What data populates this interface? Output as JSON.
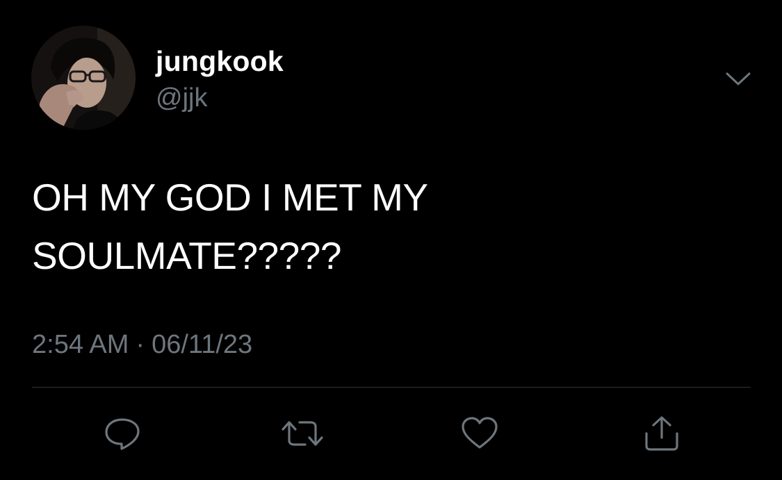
{
  "user": {
    "display_name": "jungkook",
    "handle": "@jjk",
    "avatar_icon": "profile-photo"
  },
  "tweet": {
    "lines": [
      "OH MY GOD I MET MY",
      "SOULMATE?????"
    ],
    "time": "2:54 AM",
    "separator": "·",
    "date": "06/11/23"
  },
  "actions": {
    "more_icon": "chevron-down-icon",
    "reply_icon": "reply-icon",
    "retweet_icon": "retweet-icon",
    "like_icon": "heart-icon",
    "share_icon": "share-icon"
  },
  "colors": {
    "background": "#000000",
    "primary_text": "#ffffff",
    "secondary_text": "#6e767d",
    "divider": "#2f3336",
    "icon": "#6e767d"
  }
}
